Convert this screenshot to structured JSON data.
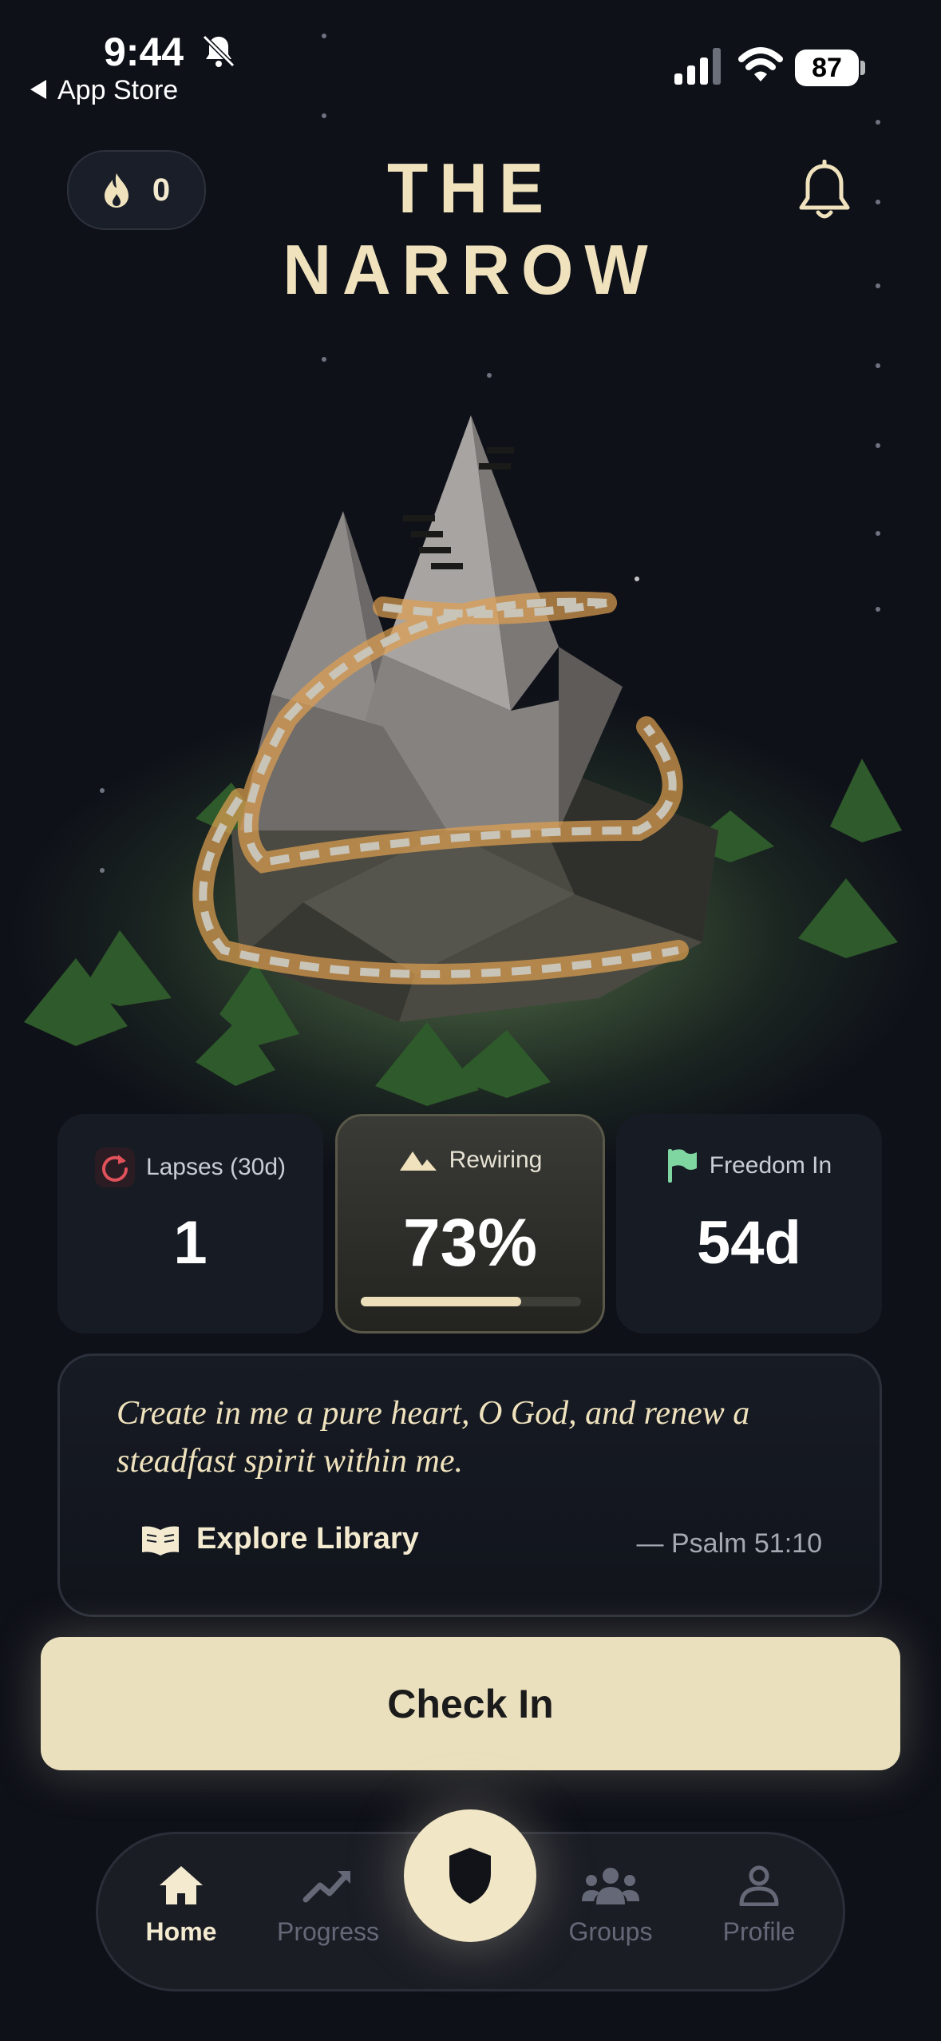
{
  "status_bar": {
    "time": "9:44",
    "back_label": "App Store",
    "battery": "87"
  },
  "header": {
    "streak_count": "0",
    "title": "THE NARROW",
    "icons": [
      "flame-icon",
      "bell-icon"
    ]
  },
  "stats": {
    "lapses": {
      "label": "Lapses (30d)",
      "value": "1",
      "icon": "refresh-icon",
      "icon_color": "#e0525b"
    },
    "rewiring": {
      "label": "Rewiring",
      "value": "73%",
      "progress": 0.73,
      "icon": "mountain-icon"
    },
    "freedom": {
      "label": "Freedom In",
      "value": "54d",
      "icon": "flag-icon",
      "icon_color": "#7fd6a0"
    }
  },
  "verse": {
    "text": "Create in me a pure heart, O God, and renew a steadfast spirit within me.",
    "reference": "— Psalm 51:10",
    "library_label": "Explore Library"
  },
  "checkin_label": "Check In",
  "tabs": [
    {
      "label": "Home",
      "icon": "home-icon",
      "active": true
    },
    {
      "label": "Progress",
      "icon": "trending-up-icon",
      "active": false
    },
    {
      "label": "Groups",
      "icon": "groups-icon",
      "active": false
    },
    {
      "label": "Profile",
      "icon": "person-icon",
      "active": false
    }
  ],
  "colors": {
    "background": "#0f1119",
    "accent_cream": "#ebe0bd",
    "card": "#171b24"
  }
}
